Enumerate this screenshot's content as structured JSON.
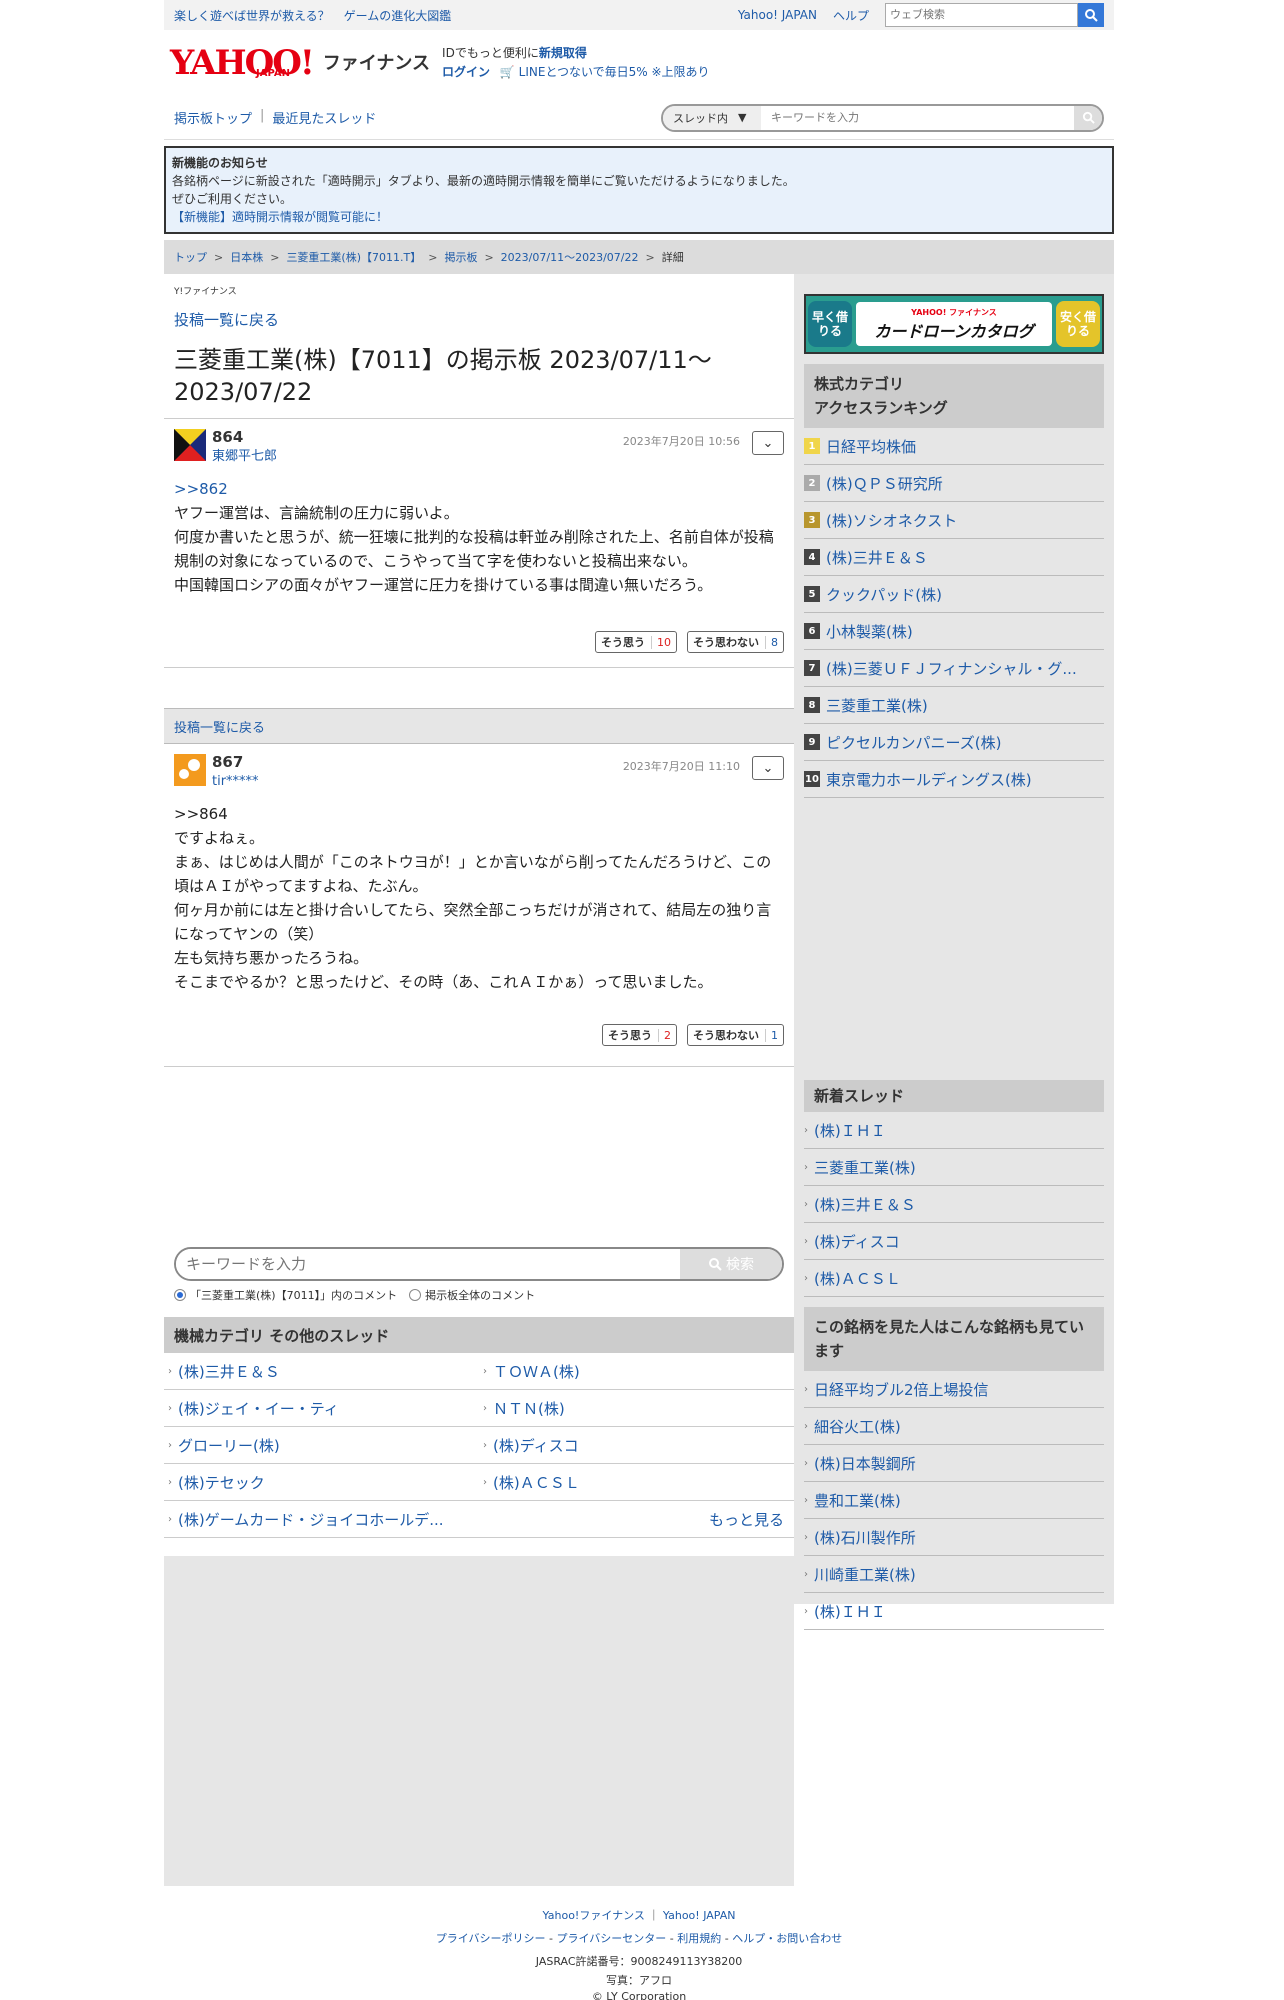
{
  "topbar": {
    "promo": [
      "楽しく遊べば世界が救える？",
      "ゲームの進化大図鑑"
    ],
    "links": [
      "Yahoo! JAPAN",
      "ヘルプ"
    ],
    "search_placeholder": "ウェブ検索"
  },
  "header": {
    "logo_text": "YAHOO!",
    "logo_sub": "JAPAN",
    "logo_fin": "ファイナンス",
    "id_text": "IDでもっと便利に",
    "signup": "新規取得",
    "login": "ログイン",
    "line_text": "LINEとつないで毎日5% ※上限あり"
  },
  "nav": {
    "links": [
      "掲示板トップ",
      "最近見たスレッド"
    ],
    "scope_label": "スレッド内",
    "search_placeholder": "キーワードを入力"
  },
  "notice": {
    "title": "新機能のお知らせ",
    "line1": "各銘柄ページに新設された「適時開示」タブより、最新の適時開示情報を簡単にご覧いただけるようになりました。",
    "line2": "ぜひご利用ください。",
    "link": "【新機能】適時開示情報が閲覧可能に！"
  },
  "breadcrumb": [
    "トップ",
    "日本株",
    "三菱重工業(株)【7011.T】",
    "掲示板",
    "2023/07/11〜2023/07/22",
    "詳細"
  ],
  "main": {
    "yfin_label": "Y!ファイナンス",
    "back_label": "投稿一覧に戻る",
    "title": "三菱重工業(株)【7011】の掲示板 2023/07/11〜2023/07/22"
  },
  "posts": [
    {
      "num": "864",
      "user": "東郷平七郎",
      "date": "2023年7月20日 10:56",
      "ref": ">>862",
      "lines": [
        "ヤフー運営は、言論統制の圧力に弱いよ。",
        "何度か書いたと思うが、統一狂壊に批判的な投稿は軒並み削除された上、名前自体が投稿規制の対象になっているので、こうやって当て字を使わないと投稿出来ない。",
        "中国韓国ロシアの面々がヤフー運営に圧力を掛けている事は間違い無いだろう。"
      ],
      "agree_label": "そう思う",
      "agree": "10",
      "disagree_label": "そう思わない",
      "disagree": "8"
    },
    {
      "num": "867",
      "user": "tir*****",
      "date": "2023年7月20日 11:10",
      "ref": ">>864",
      "lines": [
        "ですよねぇ。",
        "まぁ、はじめは人間が「このネトウヨが！」とか言いながら削ってたんだろうけど、この頃はＡＩがやってますよね、たぶん。",
        "何ヶ月か前には左と掛け合いしてたら、突然全部こっちだけが消されて、結局左の独り言になってヤンの（笑）",
        "左も気持ち悪かったろうね。",
        "そこまでやるか？と思ったけど、その時（あ、これＡＩかぁ）って思いました。"
      ],
      "agree_label": "そう思う",
      "agree": "2",
      "disagree_label": "そう思わない",
      "disagree": "1"
    }
  ],
  "search": {
    "placeholder": "キーワードを入力",
    "button": "検索",
    "radio1": "「三菱重工業(株)【7011】」内のコメント",
    "radio2": "掲示板全体のコメント"
  },
  "other_threads": {
    "title": "機械カテゴリ その他のスレッド",
    "items": [
      "(株)三井Ｅ＆Ｓ",
      "ＴＯＷＡ(株)",
      "(株)ジェイ・イー・ティ",
      "ＮＴＮ(株)",
      "グローリー(株)",
      "(株)ディスコ",
      "(株)テセック",
      "(株)ＡＣＳＬ",
      "(株)ゲームカード・ジョイコホールデ..."
    ],
    "more": "もっと見る"
  },
  "side": {
    "banner": {
      "left": "早く借りる",
      "small": "YAHOO! ファイナンス",
      "main": "カードローンカタログ",
      "right": "安く借りる"
    },
    "ranking_title1": "株式カテゴリ",
    "ranking_title2": "アクセスランキング",
    "ranking": [
      "日経平均株価",
      "(株)ＱＰＳ研究所",
      "(株)ソシオネクスト",
      "(株)三井Ｅ＆Ｓ",
      "クックパッド(株)",
      "小林製薬(株)",
      "(株)三菱ＵＦＪフィナンシャル・グ...",
      "三菱重工業(株)",
      "ピクセルカンパニーズ(株)",
      "東京電力ホールディングス(株)"
    ],
    "rank_nums": [
      "1",
      "2",
      "3",
      "4",
      "5",
      "6",
      "7",
      "8",
      "9",
      "10"
    ],
    "new_title": "新着スレッド",
    "new_threads": [
      "(株)ＩＨＩ",
      "三菱重工業(株)",
      "(株)三井Ｅ＆Ｓ",
      "(株)ディスコ",
      "(株)ＡＣＳＬ"
    ],
    "also_title": "この銘柄を見た人はこんな銘柄も見ています",
    "also": [
      "日経平均ブル2倍上場投信",
      "細谷火工(株)",
      "(株)日本製鋼所",
      "豊和工業(株)",
      "(株)石川製作所",
      "川崎重工業(株)",
      "(株)ＩＨＩ"
    ]
  },
  "footer": {
    "links1": [
      "Yahoo!ファイナンス",
      "Yahoo! JAPAN"
    ],
    "links2": [
      "プライバシーポリシー",
      "プライバシーセンター",
      "利用規約",
      "ヘルプ・お問い合わせ"
    ],
    "jasrac": "JASRAC許諾番号：9008249113Y38200",
    "photo": "写真：アフロ",
    "copy": "© LY Corporation"
  }
}
